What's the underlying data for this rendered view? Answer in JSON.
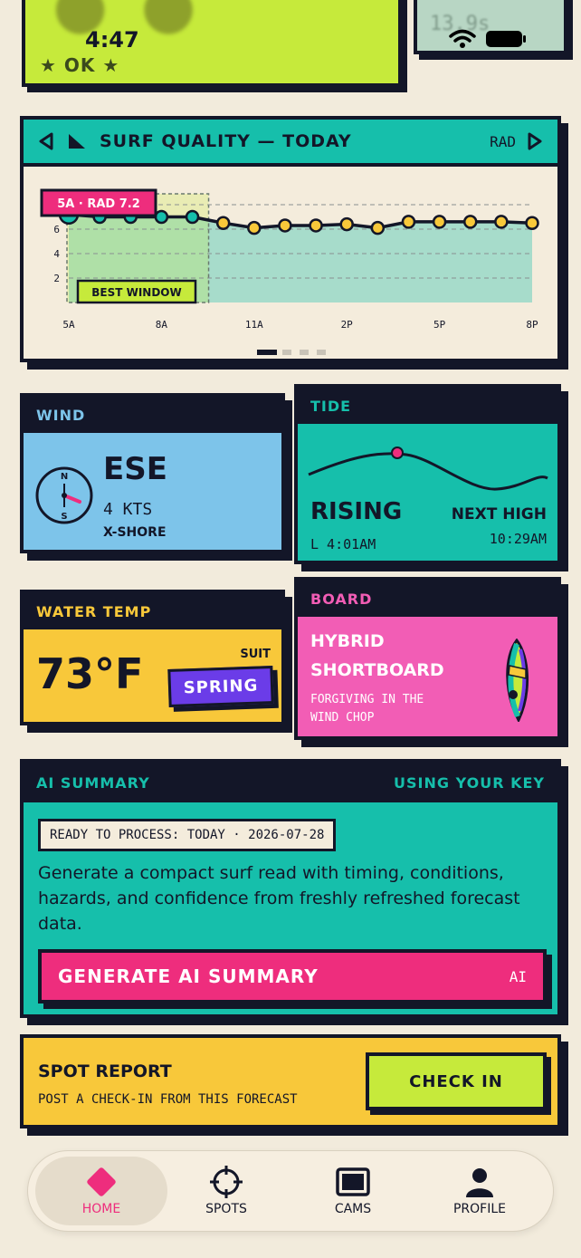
{
  "status": {
    "time": "4:47"
  },
  "hero": {
    "badge": "★ OK ★",
    "lcd": "13.9s"
  },
  "surf": {
    "title": "SURF QUALITY — TODAY",
    "mode": "RAD",
    "tooltip": "5A · RAD 7.2",
    "best_window": "BEST WINDOW",
    "pages": 4,
    "active_page": 0
  },
  "chart_data": {
    "type": "line",
    "x": [
      "5A",
      "6A",
      "7A",
      "8A",
      "9A",
      "10A",
      "11A",
      "12P",
      "1P",
      "2P",
      "3P",
      "4P",
      "5P",
      "6P",
      "7P",
      "8P"
    ],
    "values": [
      7.2,
      7.0,
      7.0,
      7.0,
      7.0,
      6.5,
      6.1,
      6.3,
      6.3,
      6.4,
      6.1,
      6.6,
      6.6,
      6.6,
      6.6,
      6.5
    ],
    "xticks": [
      "5A",
      "8A",
      "11A",
      "2P",
      "5P",
      "8P"
    ],
    "yticks": [
      "2",
      "4",
      "6"
    ],
    "ylim": [
      0,
      8
    ],
    "grid": true,
    "highlight_range": [
      "5A",
      "9A"
    ]
  },
  "wind": {
    "label": "WIND",
    "direction": "ESE",
    "speed": "4 KTS",
    "type": "X-SHORE",
    "compass_n": "N",
    "compass_s": "S"
  },
  "tide": {
    "label": "TIDE",
    "state": "RISING",
    "low": "L 4:01AM",
    "next_label": "NEXT HIGH",
    "next_time": "10:29AM"
  },
  "water": {
    "label": "WATER TEMP",
    "temp": "73°F",
    "suit_label": "SUIT",
    "suit": "SPRING"
  },
  "board": {
    "label": "BOARD",
    "name_line1": "HYBRID",
    "name_line2": "SHORTBOARD",
    "desc_line1": "FORGIVING IN THE",
    "desc_line2": "WIND CHOP"
  },
  "ai": {
    "label": "AI SUMMARY",
    "key_label": "USING YOUR KEY",
    "ready": "READY TO PROCESS: TODAY · 2026-07-28",
    "description": "Generate a compact surf read with timing, conditions, hazards, and confidence from freshly refreshed forecast data.",
    "button": "GENERATE AI SUMMARY",
    "button_tag": "AI"
  },
  "spot": {
    "title": "SPOT REPORT",
    "subtitle": "POST A CHECK-IN FROM THIS FORECAST",
    "button": "CHECK IN"
  },
  "nav": {
    "items": [
      {
        "label": "HOME",
        "icon": "home-diamond-icon"
      },
      {
        "label": "SPOTS",
        "icon": "crosshair-icon"
      },
      {
        "label": "CAMS",
        "icon": "tv-icon"
      },
      {
        "label": "PROFILE",
        "icon": "person-icon"
      }
    ]
  },
  "colors": {
    "ink": "#131628",
    "teal": "#16bfab",
    "sky": "#7dc4ea",
    "yellow": "#f8c83a",
    "pink": "#f25db5",
    "hotpink": "#ee2d7d",
    "lime": "#c6ea3b",
    "purple": "#6b3ce8"
  }
}
